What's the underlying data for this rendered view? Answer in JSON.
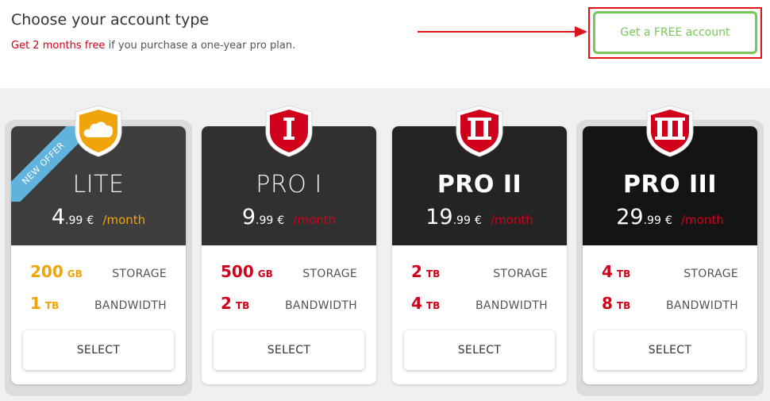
{
  "header": {
    "title": "Choose your account type",
    "promo": "Get 2 months free",
    "subtitle_rest": " if you purchase a one-year pro plan.",
    "free_button_label": "Get a FREE account"
  },
  "colors": {
    "accent_red": "#d0021b",
    "accent_orange": "#f0a30a",
    "free_green": "#79c85b",
    "highlight_red": "#e3131b",
    "ribbon_blue": "#5fb3dd"
  },
  "plans": [
    {
      "name": "LITE",
      "badge_icon": "cloud-icon",
      "ribbon": "NEW OFFER",
      "price_int": "4",
      "price_dec": ".99",
      "currency": "€",
      "period": "/month",
      "storage_value": "200",
      "storage_unit": "GB",
      "storage_label": "STORAGE",
      "bandwidth_value": "1",
      "bandwidth_unit": "TB",
      "bandwidth_label": "BANDWIDTH",
      "select_label": "SELECT"
    },
    {
      "name": "PRO I",
      "badge_icon": "shield-roman-one-icon",
      "badge_text": "I",
      "price_int": "9",
      "price_dec": ".99",
      "currency": "€",
      "period": "/month",
      "storage_value": "500",
      "storage_unit": "GB",
      "storage_label": "STORAGE",
      "bandwidth_value": "2",
      "bandwidth_unit": "TB",
      "bandwidth_label": "BANDWIDTH",
      "select_label": "SELECT"
    },
    {
      "name": "PRO II",
      "badge_icon": "shield-roman-two-icon",
      "badge_text": "II",
      "price_int": "19",
      "price_dec": ".99",
      "currency": "€",
      "period": "/month",
      "storage_value": "2",
      "storage_unit": "TB",
      "storage_label": "STORAGE",
      "bandwidth_value": "4",
      "bandwidth_unit": "TB",
      "bandwidth_label": "BANDWIDTH",
      "select_label": "SELECT"
    },
    {
      "name": "PRO III",
      "badge_icon": "shield-roman-three-icon",
      "badge_text": "III",
      "price_int": "29",
      "price_dec": ".99",
      "currency": "€",
      "period": "/month",
      "storage_value": "4",
      "storage_unit": "TB",
      "storage_label": "STORAGE",
      "bandwidth_value": "8",
      "bandwidth_unit": "TB",
      "bandwidth_label": "BANDWIDTH",
      "select_label": "SELECT"
    }
  ]
}
